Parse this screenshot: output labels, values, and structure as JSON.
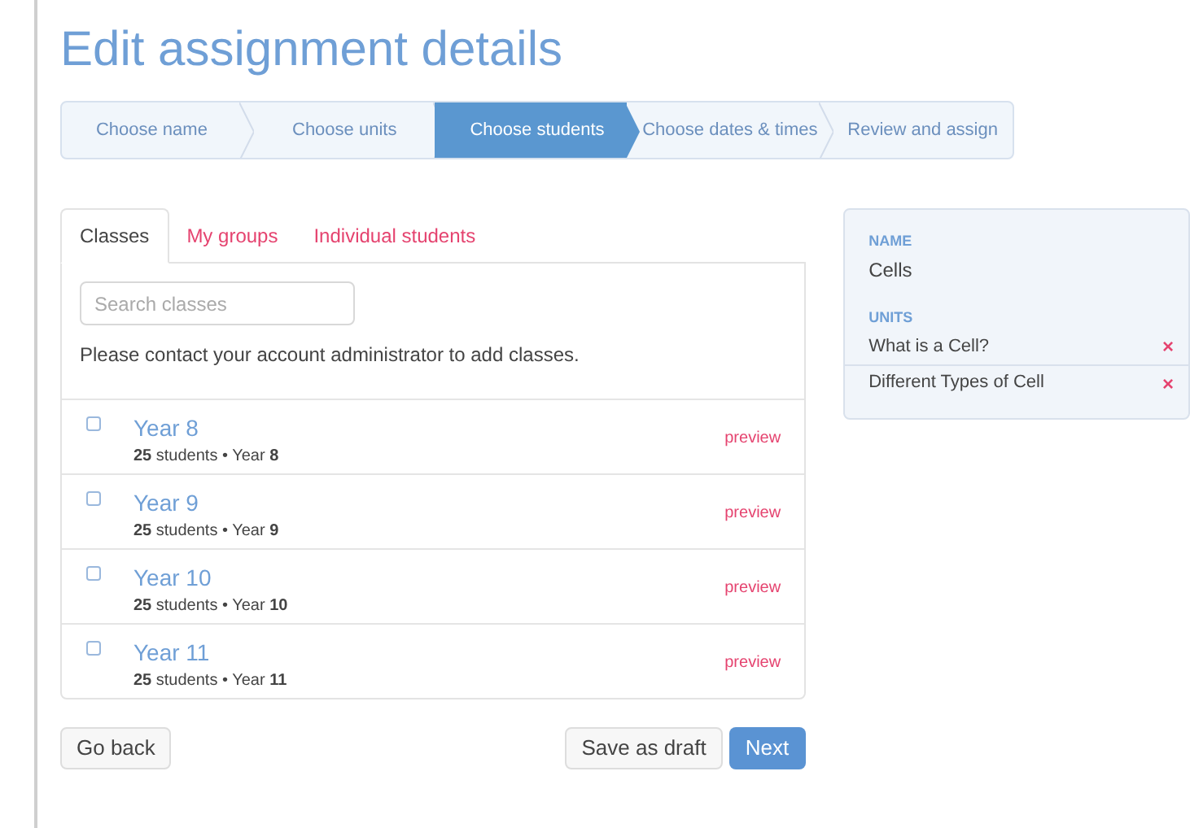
{
  "title": "Edit assignment details",
  "steps": [
    {
      "label": "Choose name",
      "selected": false
    },
    {
      "label": "Choose units",
      "selected": false
    },
    {
      "label": "Choose students",
      "selected": true
    },
    {
      "label": "Choose dates & times",
      "selected": false
    },
    {
      "label": "Review and assign",
      "selected": false
    }
  ],
  "tabs": [
    {
      "label": "Classes",
      "selected": true
    },
    {
      "label": "My groups",
      "selected": false
    },
    {
      "label": "Individual students",
      "selected": false
    }
  ],
  "search": {
    "placeholder": "Search classes"
  },
  "notice": "Please contact your account administrator to add classes.",
  "classes": [
    {
      "name": "Year 8",
      "meta": "**25** students • Year **8**",
      "checked": false,
      "action": "preview"
    },
    {
      "name": "Year 9",
      "meta": "**25** students • Year **9**",
      "checked": false,
      "action": "preview"
    },
    {
      "name": "Year 10",
      "meta": "**25** students • Year **10**",
      "checked": false,
      "action": "preview"
    },
    {
      "name": "Year 11",
      "meta": "**25** students • Year **11**",
      "checked": false,
      "action": "preview"
    }
  ],
  "buttons": {
    "back": "Go back",
    "draft": "Save as draft",
    "next": "Next"
  },
  "summary": {
    "name_label": "NAME",
    "name": "Cells",
    "units_label": "UNITS",
    "units": [
      "What is a Cell?",
      "Different Types of Cell"
    ],
    "remove": "×"
  }
}
